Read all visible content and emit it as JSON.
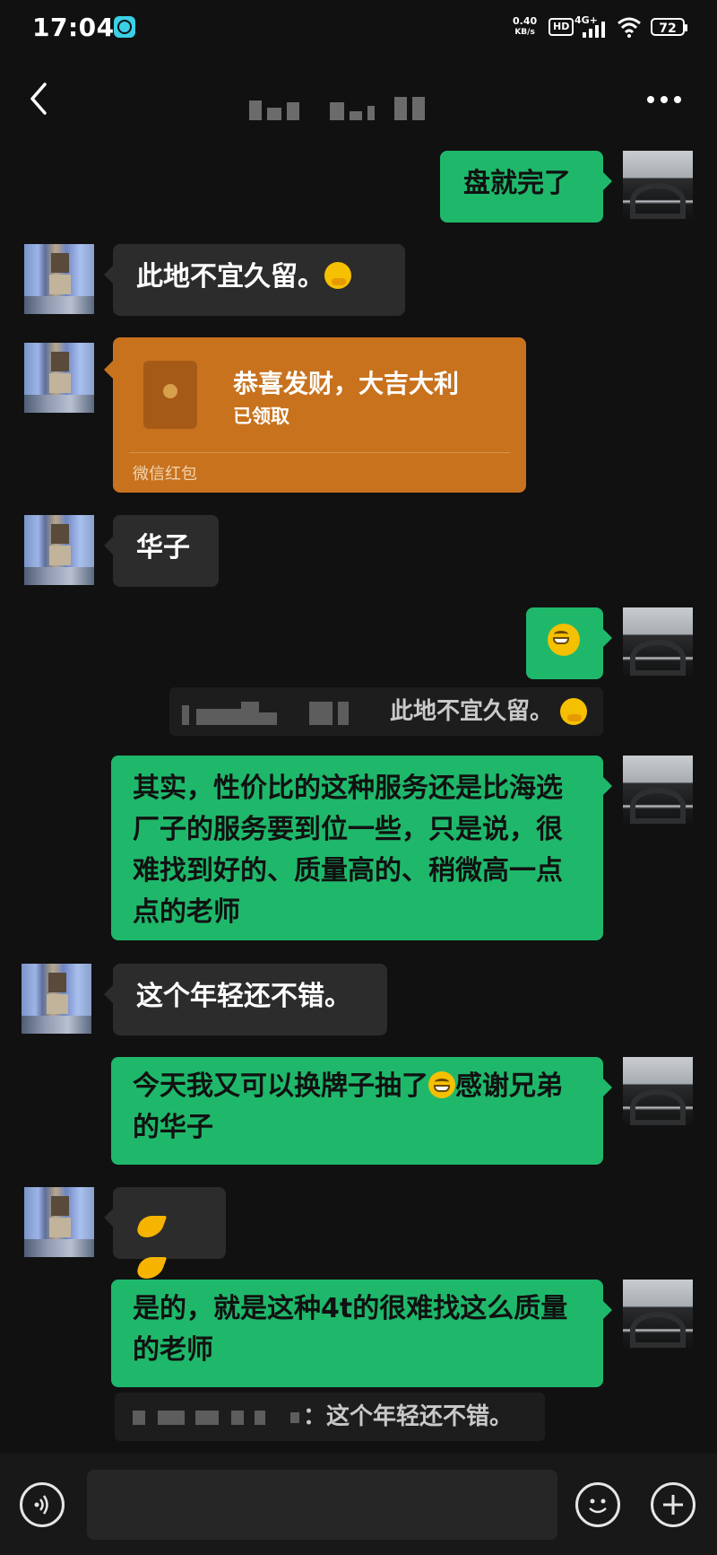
{
  "status_bar": {
    "time": "17:04",
    "net_speed_value": "0.40",
    "net_speed_unit": "KB/s",
    "hd": "HD",
    "network": "4G+",
    "battery": "72"
  },
  "header": {
    "back_icon": "chevron-left-icon",
    "more_icon": "more-dots-icon"
  },
  "messages": [
    {
      "side": "out",
      "text": "盘就完了"
    },
    {
      "side": "in",
      "text": "此地不宜久留。",
      "emoji": "thinking-face"
    },
    {
      "side": "in",
      "type": "red_packet",
      "title": "恭喜发财，大吉大利",
      "status": "已领取",
      "label": "微信红包"
    },
    {
      "side": "in",
      "text": "华子"
    },
    {
      "side": "out",
      "emoji": "grinning-face"
    },
    {
      "type": "quote",
      "text": "此地不宜久留。",
      "emoji": "thinking-face"
    },
    {
      "side": "out",
      "text": "其实，性价比的这种服务还是比海选厂子的服务要到位一些，只是说，很难找到好的、质量高的、稍微高一点点的老师"
    },
    {
      "side": "in",
      "text": "这个年轻还不错。"
    },
    {
      "side": "out",
      "text_before": "今天我又可以换牌子抽了",
      "emoji": "grinning-face",
      "text_after": "感谢兄弟的华子"
    },
    {
      "side": "in",
      "emoji": "folded-hands"
    },
    {
      "side": "out",
      "text": "是的，就是这种4t的很难找这么质量的老师"
    },
    {
      "type": "quote",
      "text": "：这个年轻还不错。"
    }
  ],
  "input_bar": {
    "voice_icon": "voice-icon",
    "emoji_icon": "emoji-icon",
    "add_icon": "plus-icon"
  }
}
